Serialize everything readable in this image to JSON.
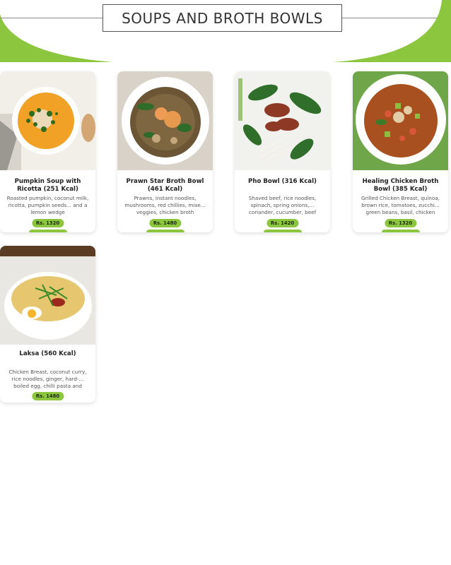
{
  "header": {
    "title": "SOUPS AND BROTH BOWLS",
    "accent_color": "#8cc63f"
  },
  "items": [
    {
      "name": "Pumpkin Soup with Ricotta (251 Kcal)",
      "description": "Roasted pumpkin, coconut milk, ricotta, pumpkin seeds... and a lemon wedge",
      "price": "Rs. 1320"
    },
    {
      "name": "Prawn Star Broth Bowl (461 Kcal)",
      "description": "Prawns, instant noodles, mushrooms, red chillies, mixe... veggies, chicken broth",
      "price": "Rs. 1480"
    },
    {
      "name": "Pho Bowl (316 Kcal)",
      "description": "Shaved beef, rice noodles, spinach, spring onions,... coriander, cucumber, beef",
      "price": "Rs. 1420"
    },
    {
      "name": "Healing Chicken Broth Bowl (385 Kcal)",
      "description": "Grilled Chicken Breast, quinoa, brown rice, tomatoes, zucchi... green beans, basil, chicken",
      "price": "Rs. 1320"
    },
    {
      "name": "Laksa (560 Kcal)",
      "description": "Chicken Breast, coconut curry, rice noodles, ginger, hard-... boiled egg, chilli pasta and",
      "price": "Rs. 1480"
    }
  ]
}
